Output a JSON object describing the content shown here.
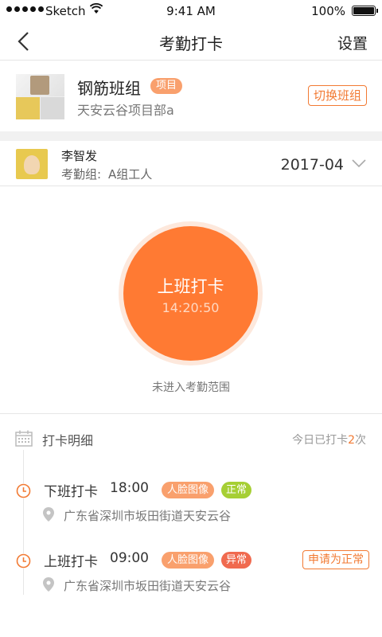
{
  "status_bar": {
    "carrier": "Sketch",
    "time": "9:41 AM",
    "battery": "100%"
  },
  "nav": {
    "title": "考勤打卡",
    "settings_label": "设置",
    "back_icon": "chevron-left-icon"
  },
  "team": {
    "name": "钢筋班组",
    "tag": "项目",
    "project": "天安云谷项目部a",
    "switch_label": "切换班组"
  },
  "user": {
    "name": "李智发",
    "group_label": "考勤组:",
    "group_value": "A组工人",
    "month": "2017-04"
  },
  "clock": {
    "label": "上班打卡",
    "time": "14:20:50",
    "note": "未进入考勤范围"
  },
  "details": {
    "title": "打卡明细",
    "count_prefix": "今日已打卡",
    "count_num": "2",
    "count_suffix": "次",
    "records": [
      {
        "type": "下班打卡",
        "time": "18:00",
        "face": "人脸图像",
        "status": "正常",
        "status_kind": "ok",
        "address": "广东省深圳市坂田街道天安云谷",
        "action": ""
      },
      {
        "type": "上班打卡",
        "time": "09:00",
        "face": "人脸图像",
        "status": "异常",
        "status_kind": "bad",
        "address": "广东省深圳市坂田街道天安云谷",
        "action": "申请为正常"
      }
    ]
  },
  "colors": {
    "accent": "#ff7a33",
    "ok": "#a6cf34",
    "error": "#f06a4f"
  }
}
